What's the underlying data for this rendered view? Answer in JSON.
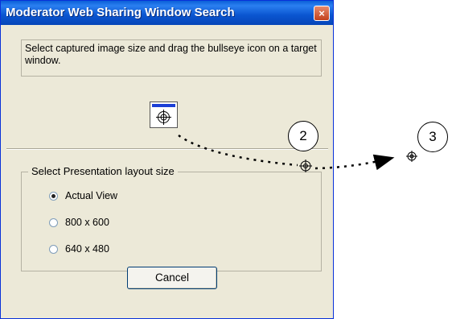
{
  "window": {
    "title": "Moderator Web Sharing Window Search",
    "close_label": "×"
  },
  "instructions": "Select captured image size and drag the bullseye icon on a target window.",
  "layout_group": {
    "legend": "Select Presentation layout size",
    "options": [
      {
        "label": "Actual View",
        "checked": true
      },
      {
        "label": "800 x 600",
        "checked": false
      },
      {
        "label": "640 x 480",
        "checked": false
      }
    ]
  },
  "cancel_label": "Cancel",
  "callouts": [
    "2",
    "3"
  ],
  "icons": {
    "bullseye": "bullseye-icon",
    "close": "close-icon",
    "arrow": "dotted-arrow"
  }
}
